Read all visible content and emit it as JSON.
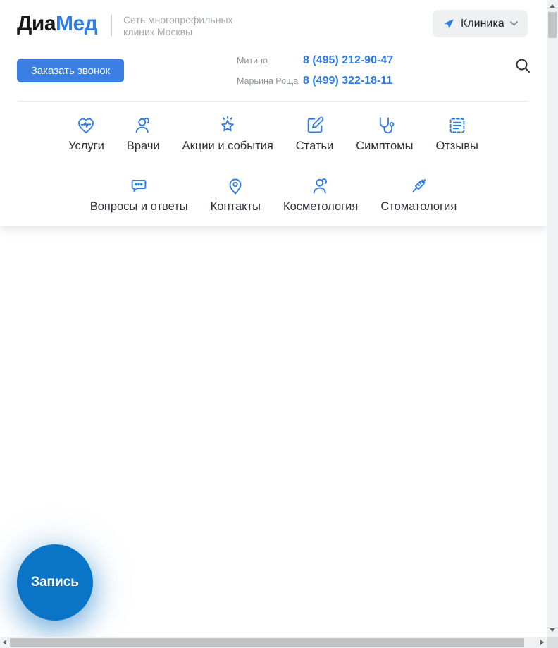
{
  "header": {
    "logo": {
      "part1": "Диа",
      "part2": "Мед"
    },
    "tagline": {
      "line1": "Сеть многопрофильных",
      "line2": "клиник Москвы"
    },
    "clinic_button_label": "Клиника",
    "order_call_button_label": "Заказать звонок",
    "phones": [
      {
        "location": "Митино",
        "number": "8 (495) 212-90-47"
      },
      {
        "location": "Марьина Роща",
        "number": "8 (499) 322-18-11"
      }
    ],
    "search_icon": "search-icon"
  },
  "nav": {
    "row1": [
      {
        "label": "Услуги",
        "icon": "heart-pulse-icon"
      },
      {
        "label": "Врачи",
        "icon": "doctor-icon"
      },
      {
        "label": "Акции и события",
        "icon": "star-icon"
      },
      {
        "label": "Статьи",
        "icon": "edit-icon"
      },
      {
        "label": "Симптомы",
        "icon": "stethoscope-icon"
      },
      {
        "label": "Отзывы",
        "icon": "review-list-icon"
      }
    ],
    "row2": [
      {
        "label": "Вопросы и ответы",
        "icon": "chat-icon"
      },
      {
        "label": "Контакты",
        "icon": "map-pin-icon"
      },
      {
        "label": "Косметология",
        "icon": "person-icon"
      },
      {
        "label": "Стоматология",
        "icon": "syringe-icon"
      }
    ]
  },
  "floating": {
    "appointment_label": "Запись"
  },
  "colors": {
    "accent_blue": "#2f7de4",
    "call_button_blue": "#3b7ee2",
    "appointment_circle_blue": "#0a74c6",
    "text_dark": "#2d3238",
    "text_gray": "#8d949b"
  }
}
